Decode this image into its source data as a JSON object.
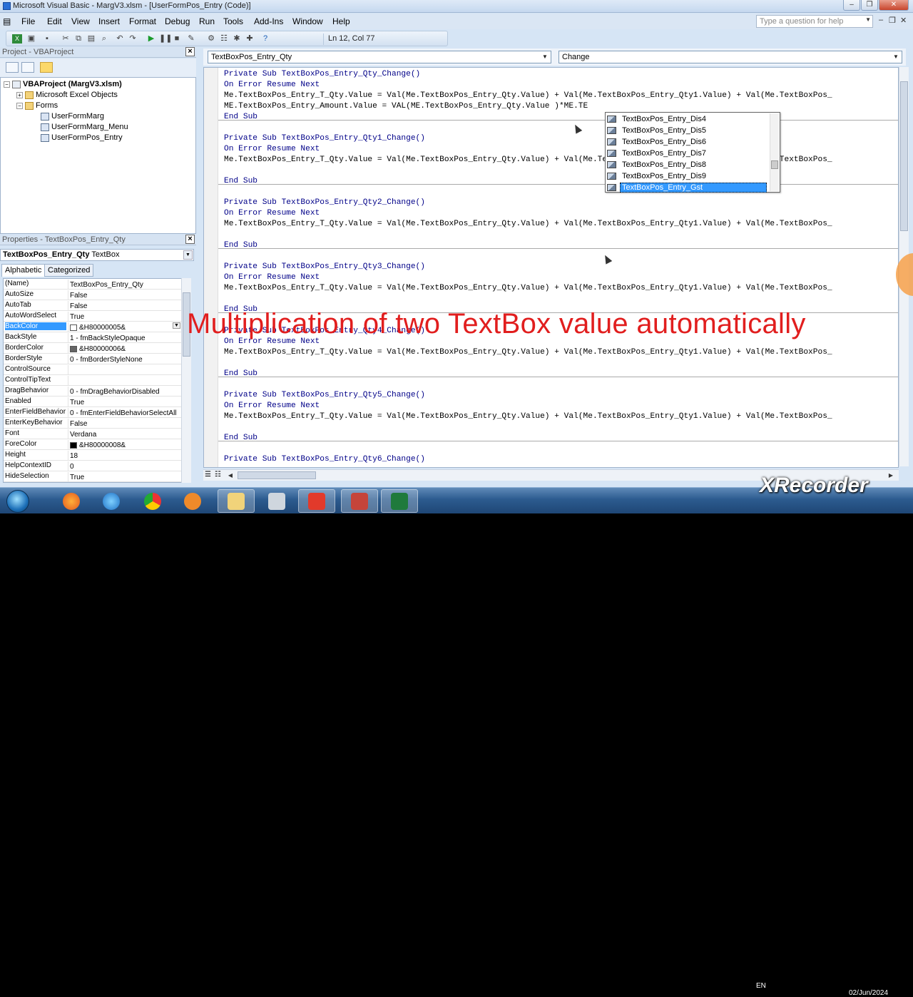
{
  "window": {
    "title": "Microsoft Visual Basic - MargV3.xlsm - [UserFormPos_Entry (Code)]",
    "help_placeholder": "Type a question for help"
  },
  "menu": [
    "File",
    "Edit",
    "View",
    "Insert",
    "Format",
    "Debug",
    "Run",
    "Tools",
    "Add-Ins",
    "Window",
    "Help"
  ],
  "toolbar": {
    "position": "Ln 12, Col 77"
  },
  "project": {
    "title": "Project - VBAProject",
    "tree": {
      "root": "VBAProject (MargV3.xlsm)",
      "objects_folder": "Microsoft Excel Objects",
      "forms_folder": "Forms",
      "forms": [
        "UserFormMarg",
        "UserFormMarg_Menu",
        "UserFormPos_Entry"
      ]
    }
  },
  "properties": {
    "title": "Properties - TextBoxPos_Entry_Qty",
    "object_name": "TextBoxPos_Entry_Qty",
    "object_type": "TextBox",
    "tabs": [
      "Alphabetic",
      "Categorized"
    ],
    "rows": [
      {
        "name": "(Name)",
        "value": "TextBoxPos_Entry_Qty"
      },
      {
        "name": "AutoSize",
        "value": "False"
      },
      {
        "name": "AutoTab",
        "value": "False"
      },
      {
        "name": "AutoWordSelect",
        "value": "True"
      },
      {
        "name": "BackColor",
        "value": "&H80000005&",
        "swatch": "#ffffff"
      },
      {
        "name": "BackStyle",
        "value": "1 - fmBackStyleOpaque"
      },
      {
        "name": "BorderColor",
        "value": "&H80000006&",
        "swatch": "#646464"
      },
      {
        "name": "BorderStyle",
        "value": "0 - fmBorderStyleNone"
      },
      {
        "name": "ControlSource",
        "value": ""
      },
      {
        "name": "ControlTipText",
        "value": ""
      },
      {
        "name": "DragBehavior",
        "value": "0 - fmDragBehaviorDisabled"
      },
      {
        "name": "Enabled",
        "value": "True"
      },
      {
        "name": "EnterFieldBehavior",
        "value": "0 - fmEnterFieldBehaviorSelectAll"
      },
      {
        "name": "EnterKeyBehavior",
        "value": "False"
      },
      {
        "name": "Font",
        "value": "Verdana"
      },
      {
        "name": "ForeColor",
        "value": "&H80000008&",
        "swatch": "#000000"
      },
      {
        "name": "Height",
        "value": "18"
      },
      {
        "name": "HelpContextID",
        "value": "0"
      },
      {
        "name": "HideSelection",
        "value": "True"
      }
    ]
  },
  "code": {
    "object_combo": "TextBoxPos_Entry_Qty",
    "proc_combo": "Change",
    "lines": [
      "Private Sub TextBoxPos_Entry_Qty_Change()",
      "On Error Resume Next",
      "Me.TextBoxPos_Entry_T_Qty.Value = Val(Me.TextBoxPos_Entry_Qty.Value) + Val(Me.TextBoxPos_Entry_Qty1.Value) + Val(Me.TextBoxPos_",
      "ME.TextBoxPos_Entry_Amount.Value = VAL(ME.TextBoxPos_Entry_Qty.Value )*ME.TE",
      "End Sub",
      "",
      "Private Sub TextBoxPos_Entry_Qty1_Change()",
      "On Error Resume Next",
      "Me.TextBoxPos_Entry_T_Qty.Value = Val(Me.TextBoxPos_Entry_Qty.Value) + Val(Me.TextBoxPos_Entry_Qty1.Value) + Val(Me.TextBoxPos_",
      "",
      "End Sub",
      "",
      "Private Sub TextBoxPos_Entry_Qty2_Change()",
      "On Error Resume Next",
      "Me.TextBoxPos_Entry_T_Qty.Value = Val(Me.TextBoxPos_Entry_Qty.Value) + Val(Me.TextBoxPos_Entry_Qty1.Value) + Val(Me.TextBoxPos_",
      "",
      "End Sub",
      "",
      "Private Sub TextBoxPos_Entry_Qty3_Change()",
      "On Error Resume Next",
      "Me.TextBoxPos_Entry_T_Qty.Value = Val(Me.TextBoxPos_Entry_Qty.Value) + Val(Me.TextBoxPos_Entry_Qty1.Value) + Val(Me.TextBoxPos_",
      "",
      "End Sub",
      "",
      "Private Sub TextBoxPos_Entry_Qty4_Change()",
      "On Error Resume Next",
      "Me.TextBoxPos_Entry_T_Qty.Value = Val(Me.TextBoxPos_Entry_Qty.Value) + Val(Me.TextBoxPos_Entry_Qty1.Value) + Val(Me.TextBoxPos_",
      "",
      "End Sub",
      "",
      "Private Sub TextBoxPos_Entry_Qty5_Change()",
      "On Error Resume Next",
      "Me.TextBoxPos_Entry_T_Qty.Value = Val(Me.TextBoxPos_Entry_Qty.Value) + Val(Me.TextBoxPos_Entry_Qty1.Value) + Val(Me.TextBoxPos_",
      "",
      "End Sub",
      "",
      "Private Sub TextBoxPos_Entry_Qty6_Change()"
    ],
    "intellisense": [
      "TextBoxPos_Entry_Dis4",
      "TextBoxPos_Entry_Dis5",
      "TextBoxPos_Entry_Dis6",
      "TextBoxPos_Entry_Dis7",
      "TextBoxPos_Entry_Dis8",
      "TextBoxPos_Entry_Dis9",
      "TextBoxPos_Entry_Gst"
    ]
  },
  "overlay": {
    "caption": "Multiplication of two TextBox value automatically",
    "caption_color": "#e11e1e",
    "watermark": "XRecorder"
  },
  "taskbar": {
    "language": "EN",
    "date": "02/Jun/2024"
  }
}
